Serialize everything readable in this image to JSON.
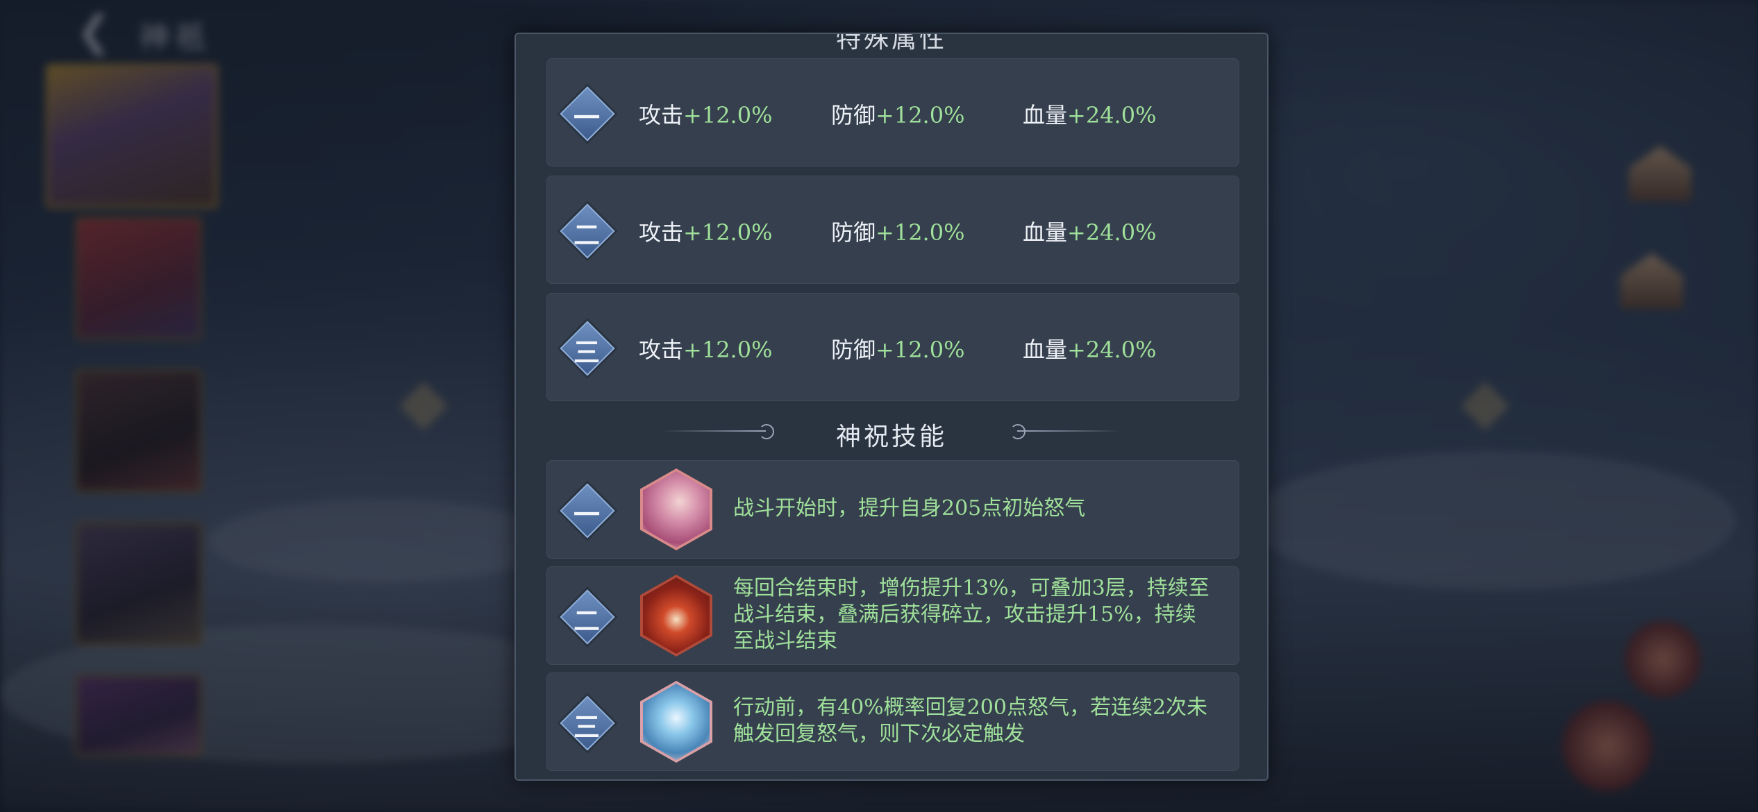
{
  "background": {
    "back_title": "神祇",
    "back_icon": "back-arrow-icon"
  },
  "panel": {
    "top_title": "特殊属性",
    "attr_rows": [
      {
        "badge": "一",
        "atk_label": "攻击",
        "atk_val": "+12.0%",
        "def_label": "防御",
        "def_val": "+12.0%",
        "hp_label": "血量",
        "hp_val": "+24.0%"
      },
      {
        "badge": "二",
        "atk_label": "攻击",
        "atk_val": "+12.0%",
        "def_label": "防御",
        "def_val": "+12.0%",
        "hp_label": "血量",
        "hp_val": "+24.0%"
      },
      {
        "badge": "三",
        "atk_label": "攻击",
        "atk_val": "+12.0%",
        "def_label": "防御",
        "def_val": "+12.0%",
        "hp_label": "血量",
        "hp_val": "+24.0%"
      }
    ],
    "skills_title": "神祝技能",
    "skills": [
      {
        "badge": "一",
        "icon": "pink-hair-girl-portrait-icon",
        "text": "战斗开始时，提升自身205点初始怒气"
      },
      {
        "badge": "二",
        "icon": "red-beast-portrait-icon",
        "text": "每回合结束时，增伤提升13%，可叠加3层，持续至战斗结束，叠满后获得碎立，攻击提升15%，持续至战斗结束"
      },
      {
        "badge": "三",
        "icon": "ice-dragon-portrait-icon",
        "text": "行动前，有40%概率回复200点怒气，若连续2次未触发回复怒气，则下次必定触发"
      }
    ]
  },
  "colors": {
    "panel_bg": "#2a3340",
    "row_bg": "#353f4d",
    "value_green": "#9fe09a",
    "badge_blue": "#4e6fa3"
  }
}
